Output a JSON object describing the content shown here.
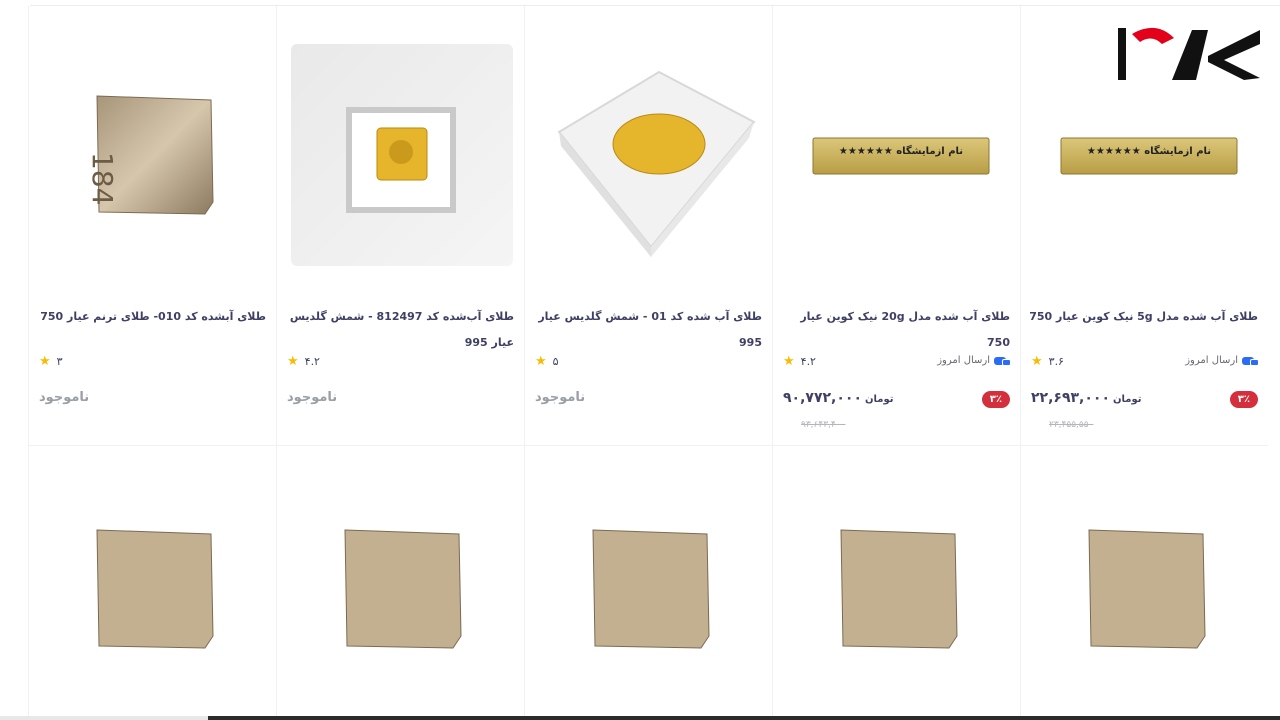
{
  "brand": {
    "logo_name": "rokna-logo"
  },
  "products_row1": [
    {
      "title": "طلای آبشده کد 010- طلای ترنم عیار 750",
      "rating": "۳",
      "status": "ناموجود",
      "image": "gold-bar-rough"
    },
    {
      "title": "طلای آب‌شده کد 812497 - شمش گلدیس عیار 995",
      "rating": "۴.۲",
      "status": "ناموجود",
      "image": "gold-cube-box"
    },
    {
      "title": "طلای آب شده کد 01 - شمش گلدیس عیار 995",
      "rating": "۵",
      "status": "ناموجود",
      "image": "gold-cube-white-box"
    },
    {
      "title": "طلای آب شده مدل 20g نیک کوین عیار 750",
      "rating": "۴.۲",
      "shipping": "ارسال امروز",
      "price": "۹۰,۷۷۲,۰۰۰",
      "currency": "تومان",
      "old_price": "۹۳,۶۴۳,۴۰۰",
      "discount": "۳٪",
      "image": "gold-bar-label",
      "bar_label": "نام ازمایشگاه ★★★★★★"
    },
    {
      "title": "طلای آب شده مدل 5g نیک کوین عیار 750",
      "rating": "۳.۶",
      "shipping": "ارسال امروز",
      "price": "۲۲,۶۹۳,۰۰۰",
      "currency": "تومان",
      "old_price": "۲۳,۴۵۵,۵۵۰",
      "discount": "۳٪",
      "image": "gold-bar-label",
      "bar_label": "نام ازمایشگاه ★★★★★★"
    }
  ],
  "products_row2": [
    {
      "image": "gold-bar-rough"
    },
    {
      "image": "gold-bar-rough"
    },
    {
      "image": "gold-bar-rough"
    },
    {
      "image": "gold-bar-rough"
    },
    {
      "image": "gold-bar-rough"
    }
  ],
  "colors": {
    "star": "#f9bc00",
    "discount": "#d32f3d",
    "ship_icon": "#2a6cf6",
    "logo_red": "#e2001a"
  }
}
